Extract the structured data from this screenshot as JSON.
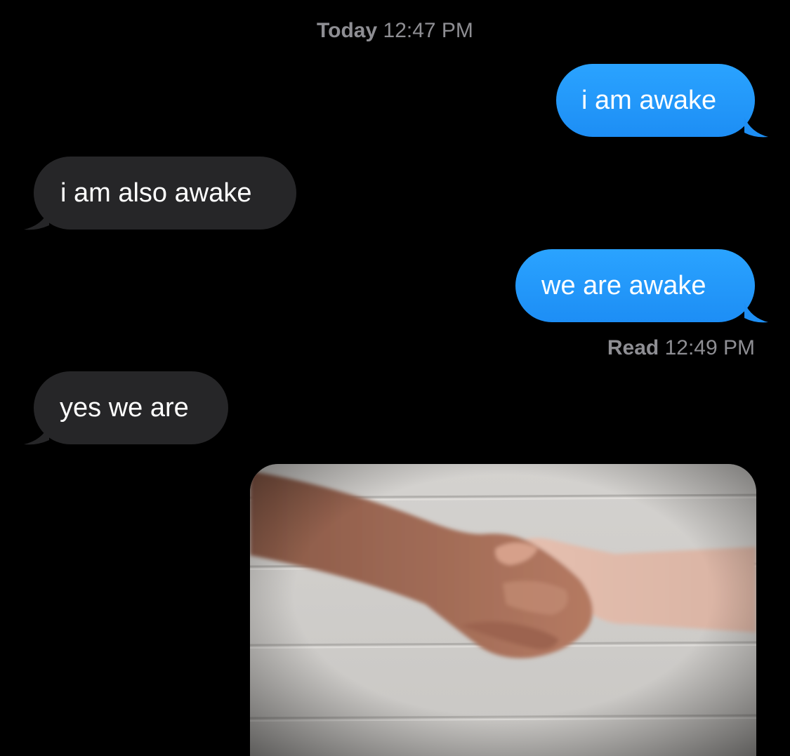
{
  "conversation": {
    "timestamp": {
      "day": "Today",
      "time": "12:47 PM"
    },
    "messages": [
      {
        "direction": "sent",
        "text": "i am awake"
      },
      {
        "direction": "received",
        "text": "i am also awake"
      },
      {
        "direction": "sent",
        "text": "we are awake"
      },
      {
        "direction": "received",
        "text": "yes we are"
      }
    ],
    "read_receipt": {
      "label": "Read",
      "time": "12:49 PM"
    },
    "attachment": {
      "kind": "image",
      "subject": "handshake-photo"
    }
  },
  "colors": {
    "background": "#000000",
    "sent_bubble": "#1e8ff5",
    "received_bubble": "#262628",
    "meta_text": "#8e8e93"
  }
}
